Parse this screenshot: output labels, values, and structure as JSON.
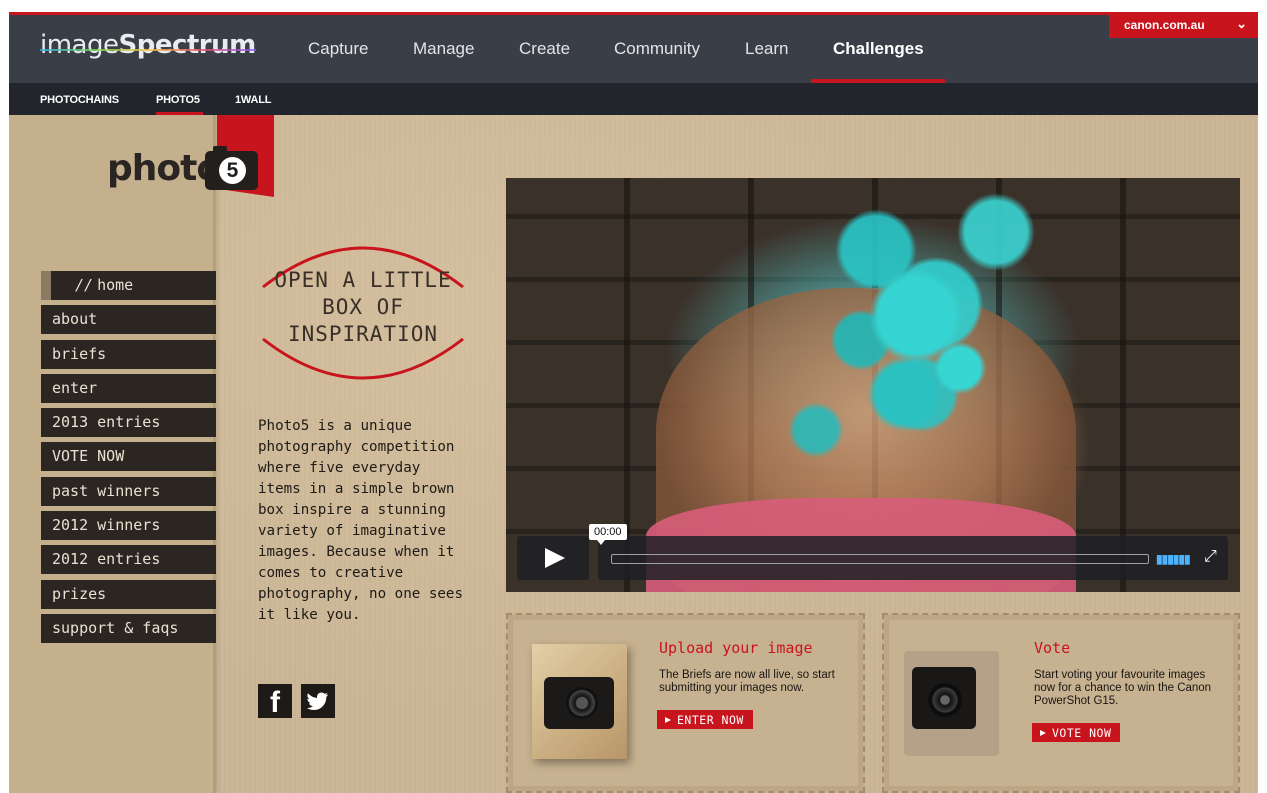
{
  "header": {
    "logo_text_light": "image",
    "logo_text_bold": "Spectrum",
    "nav": [
      "Capture",
      "Manage",
      "Create",
      "Community",
      "Learn",
      "Challenges"
    ],
    "active_nav": "Challenges",
    "region_button": "canon.com.au"
  },
  "subnav": {
    "items": [
      "PHOTOCHAINS",
      "PHOTO5",
      "1WALL"
    ],
    "active": "PHOTO5"
  },
  "brand": {
    "logo_word": "photo",
    "logo_number": "5"
  },
  "sidebar": {
    "items": [
      {
        "slash": "//",
        "label": "home"
      },
      {
        "label": "about"
      },
      {
        "label": "briefs"
      },
      {
        "label": "enter"
      },
      {
        "label": "2013 entries"
      },
      {
        "label": "VOTE NOW"
      },
      {
        "label": "past winners"
      },
      {
        "label": "2012 winners"
      },
      {
        "label": "2012 entries"
      },
      {
        "label": "prizes"
      },
      {
        "label": "support & faqs"
      }
    ]
  },
  "hero": {
    "headline_lines": [
      "OPEN A LITTLE",
      "BOX OF",
      "INSPIRATION"
    ],
    "blurb": "Photo5 is a unique photography competition where five everyday items in a simple brown box inspire a stunning variety of imaginative images. Because when it comes to creative photography, no one sees it like you."
  },
  "social": {
    "facebook": "f",
    "twitter": "twitter-bird-icon"
  },
  "video": {
    "time": "00:00"
  },
  "cards": {
    "upload": {
      "title": "Upload your image",
      "text": "The Briefs are now all live, so start submitting your images now.",
      "button": "ENTER NOW"
    },
    "vote": {
      "title": "Vote",
      "text": "Start voting your favourite images now for a chance to win the Canon PowerShot G15.",
      "button": "VOTE NOW"
    }
  },
  "colors": {
    "accent": "#c8141c",
    "topnav": "#3a3e46",
    "subnav": "#22262c",
    "cardboard": "#cbb797",
    "menu": "#2b2622"
  }
}
